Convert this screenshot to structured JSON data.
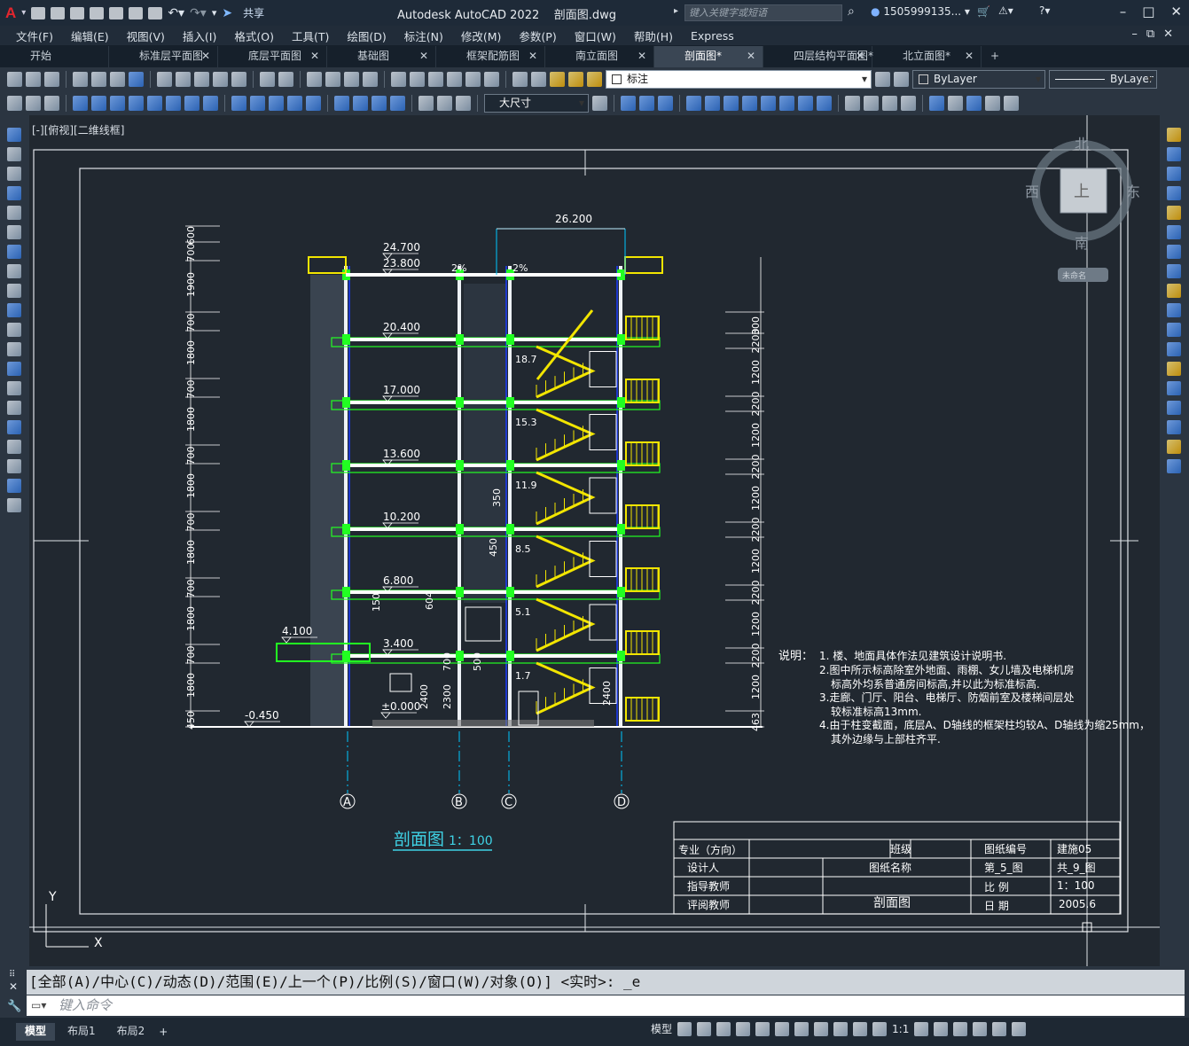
{
  "app": {
    "logo": "A",
    "title": "Autodesk AutoCAD 2022",
    "filename": "剖面图.dwg",
    "share_label": "共享",
    "search_placeholder": "键入关键字或短语",
    "user": "1505999135..."
  },
  "menu": [
    "文件(F)",
    "编辑(E)",
    "视图(V)",
    "插入(I)",
    "格式(O)",
    "工具(T)",
    "绘图(D)",
    "标注(N)",
    "修改(M)",
    "参数(P)",
    "窗口(W)",
    "帮助(H)",
    "Express"
  ],
  "tabs": [
    {
      "label": "开始",
      "active": false,
      "closable": false
    },
    {
      "label": "标准层平面图",
      "active": false,
      "closable": true
    },
    {
      "label": "底层平面图",
      "active": false,
      "closable": true
    },
    {
      "label": "基础图",
      "active": false,
      "closable": true
    },
    {
      "label": "框架配筋图",
      "active": false,
      "closable": true
    },
    {
      "label": "南立面图",
      "active": false,
      "closable": true
    },
    {
      "label": "剖面图*",
      "active": true,
      "closable": true
    },
    {
      "label": "四层结构平面图*",
      "active": false,
      "closable": true
    },
    {
      "label": "北立面图*",
      "active": false,
      "closable": true
    }
  ],
  "toolbar": {
    "layer_combo": "标注",
    "color_combo": "ByLayer",
    "linetype_combo": "ByLayer",
    "dimstyle_combo": "大尺寸"
  },
  "viewport": {
    "label": "[-][俯视][二维线框]",
    "navcube": {
      "north": "北",
      "south": "南",
      "east": "东",
      "west": "西",
      "top": "上",
      "ucs": "未命名"
    }
  },
  "drawing": {
    "title": "剖面图",
    "scale": "1：100",
    "elevations": [
      "24.700",
      "23.800",
      "20.400",
      "17.000",
      "13.600",
      "10.200",
      "6.800",
      "3.400",
      "±0.000",
      "-0.450",
      "4.100"
    ],
    "stair_elevations": [
      "18.7",
      "15.3",
      "11.9",
      "8.5",
      "5.1",
      "1.7"
    ],
    "top_elevation": "26.200",
    "axes": [
      "A",
      "B",
      "C",
      "D"
    ],
    "left_dims": [
      "450",
      "1800",
      "700",
      "1800",
      "700",
      "1800",
      "700",
      "1800",
      "700",
      "1800",
      "700",
      "1800",
      "700",
      "1900",
      "700",
      "600"
    ],
    "right_dims": [
      "300",
      "2200",
      "1200",
      "2200",
      "1200",
      "2200",
      "1200",
      "2200",
      "1200",
      "2200",
      "1200",
      "2200",
      "1200",
      "463"
    ],
    "slope": "2%",
    "small_dims": [
      "350",
      "450",
      "604",
      "150",
      "700",
      "500",
      "2400",
      "2300",
      "2400"
    ],
    "notes_title": "说明：",
    "notes": [
      "1. 楼、地面具体作法见建筑设计说明书.",
      "2.图中所示标高除室外地面、雨棚、女儿墙及电梯机房",
      "标高外均系普通房间标高,并以此为标准标高.",
      "3.走廊、门厅、阳台、电梯厅、防烟前室及楼梯间层处",
      "较标准标高13mm.",
      "4.由于柱变截面，底层A、D轴线的框架柱均较A、D轴线为缩25mm，",
      "其外边缘与上部柱齐平."
    ],
    "titleblock": {
      "major": "专业（方向）",
      "class": "班级",
      "drawing_no_label": "图纸编号",
      "drawing_no": "建施05",
      "designer": "设计人",
      "drawing_name_label": "图纸名称",
      "sheet": "第_5_图",
      "total": "共_9_图",
      "advisor": "指导教师",
      "scale_label": "比 例",
      "scale_val": "1：100",
      "reviewer": "评阅教师",
      "drawing_name": "剖面图",
      "date_label": "日 期",
      "date_val": "2005.6"
    }
  },
  "command": {
    "history": "[全部(A)/中心(C)/动态(D)/范围(E)/上一个(P)/比例(S)/窗口(W)/对象(O)] <实时>: _e",
    "placeholder": "键入命令"
  },
  "layouts": [
    "模型",
    "布局1",
    "布局2"
  ],
  "status": {
    "model_label": "模型",
    "scale": "1:1"
  }
}
